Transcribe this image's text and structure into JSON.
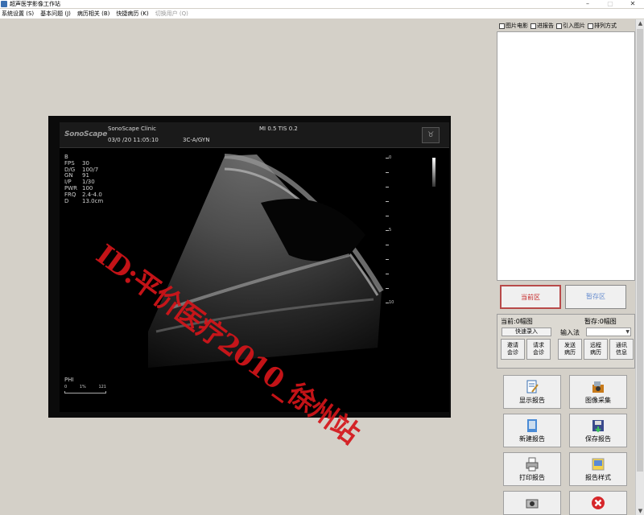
{
  "window": {
    "title": "超声医学影像工作站"
  },
  "menu": [
    {
      "label": "系统设置 (S)",
      "disabled": false
    },
    {
      "label": "基本问题 (J)",
      "disabled": false
    },
    {
      "label": "病历相关 (B)",
      "disabled": false
    },
    {
      "label": "快捷病历 (K)",
      "disabled": false
    },
    {
      "label": "切换用户 (Q)",
      "disabled": true
    }
  ],
  "ultrasound": {
    "logo": "SonoScape",
    "clinic": "SonoScape Clinic",
    "date": "03/0 /20  11:05:10",
    "probe": "3C-A/GYN",
    "mi_tis": "MI 0.5  TIS 0.2",
    "params": [
      {
        "k": "B",
        "v": ""
      },
      {
        "k": "FPS",
        "v": "30"
      },
      {
        "k": "D/G",
        "v": "100/7"
      },
      {
        "k": "GN",
        "v": "91"
      },
      {
        "k": "I/P",
        "v": "1/30"
      },
      {
        "k": "PWR",
        "v": "100"
      },
      {
        "k": "FRQ",
        "v": "2.4-4.0"
      },
      {
        "k": "D",
        "v": "13.0cm"
      }
    ],
    "phi": "PHI",
    "phi_scale": [
      "0",
      "1%",
      "121"
    ],
    "depth_labels": [
      "0",
      "5",
      "10"
    ],
    "watermark": "ID:平价医疗2010_徐州站"
  },
  "right_panel": {
    "checkboxes": [
      "图片电影",
      "进报告",
      "引入图片",
      "排列方式"
    ],
    "current_area": "当前区",
    "temp_area": "暂存区",
    "current_count": "当前:0幅图",
    "temp_count": "暂存:0幅图",
    "quick_entry": "快速录入",
    "ime_label": "输入法",
    "small_buttons": [
      {
        "l1": "邀请",
        "l2": "会诊"
      },
      {
        "l1": "请求",
        "l2": "会诊"
      },
      {
        "l1": "发送",
        "l2": "病历"
      },
      {
        "l1": "远程",
        "l2": "病历"
      },
      {
        "l1": "通讯",
        "l2": "信息"
      }
    ],
    "big_buttons": [
      {
        "label": "显示报告",
        "icon": "report-edit-icon"
      },
      {
        "label": "图像采集",
        "icon": "image-capture-icon"
      },
      {
        "label": "新建报告",
        "icon": "new-report-icon"
      },
      {
        "label": "保存报告",
        "icon": "save-report-icon"
      },
      {
        "label": "打印报告",
        "icon": "printer-icon"
      },
      {
        "label": "报告样式",
        "icon": "report-style-icon"
      },
      {
        "label": "",
        "icon": "camera-icon"
      },
      {
        "label": "",
        "icon": "close-icon"
      }
    ]
  },
  "colors": {
    "current_area": "#c62828",
    "temp_area": "#6a8fd0",
    "watermark": "#d4151a"
  }
}
